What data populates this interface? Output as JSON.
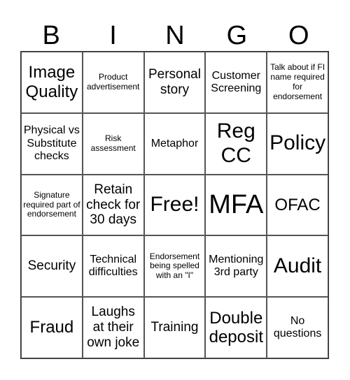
{
  "title_letters": [
    "B",
    "I",
    "N",
    "G",
    "O"
  ],
  "cells": [
    [
      {
        "text": "Image Quality",
        "size": "xl"
      },
      {
        "text": "Product advertisement",
        "size": "xs"
      },
      {
        "text": "Personal story",
        "size": "m"
      },
      {
        "text": "Customer Screening",
        "size": "s"
      },
      {
        "text": "Talk about if FI name required for endorsement",
        "size": "xs"
      }
    ],
    [
      {
        "text": "Physical vs Substitute checks",
        "size": "s"
      },
      {
        "text": "Risk assessment",
        "size": "xs"
      },
      {
        "text": "Metaphor",
        "size": "s"
      },
      {
        "text": "Reg CC",
        "size": "xxl"
      },
      {
        "text": "Policy",
        "size": "xxl"
      }
    ],
    [
      {
        "text": "Signature required part of endorsement",
        "size": "xs"
      },
      {
        "text": "Retain check for 30 days",
        "size": "m"
      },
      {
        "text": "Free!",
        "size": "xxl"
      },
      {
        "text": "MFA",
        "size": "xxxl"
      },
      {
        "text": "OFAC",
        "size": "l"
      }
    ],
    [
      {
        "text": "Security",
        "size": "m"
      },
      {
        "text": "Technical difficulties",
        "size": "s"
      },
      {
        "text": "Endorsement being spelled with an \"I\"",
        "size": "xs"
      },
      {
        "text": "Mentioning 3rd party",
        "size": "s"
      },
      {
        "text": "Audit",
        "size": "xxl"
      }
    ],
    [
      {
        "text": "Fraud",
        "size": "xl"
      },
      {
        "text": "Laughs at their own joke",
        "size": "m"
      },
      {
        "text": "Training",
        "size": "m"
      },
      {
        "text": "Double deposit",
        "size": "l"
      },
      {
        "text": "No questions",
        "size": "s"
      }
    ]
  ]
}
